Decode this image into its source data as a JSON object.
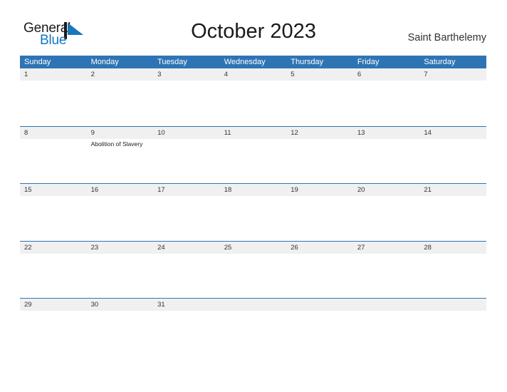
{
  "brand": {
    "name_part1": "General",
    "name_part2": "Blue",
    "mark_icon": "sail-triangle-icon",
    "dark_color": "#1a1a1a",
    "blue_color": "#1077c3"
  },
  "header": {
    "title": "October 2023",
    "region": "Saint Barthelemy"
  },
  "theme": {
    "header_blue": "#2e74b5",
    "day_band_gray": "#f0f0f0",
    "row_rule_blue": "#2e74b5",
    "text_dark": "#333333"
  },
  "calendar": {
    "weekdays": [
      "Sunday",
      "Monday",
      "Tuesday",
      "Wednesday",
      "Thursday",
      "Friday",
      "Saturday"
    ],
    "weeks": [
      {
        "days": [
          {
            "num": "1",
            "events": []
          },
          {
            "num": "2",
            "events": []
          },
          {
            "num": "3",
            "events": []
          },
          {
            "num": "4",
            "events": []
          },
          {
            "num": "5",
            "events": []
          },
          {
            "num": "6",
            "events": []
          },
          {
            "num": "7",
            "events": []
          }
        ]
      },
      {
        "days": [
          {
            "num": "8",
            "events": []
          },
          {
            "num": "9",
            "events": [
              "Abolition of Slavery"
            ]
          },
          {
            "num": "10",
            "events": []
          },
          {
            "num": "11",
            "events": []
          },
          {
            "num": "12",
            "events": []
          },
          {
            "num": "13",
            "events": []
          },
          {
            "num": "14",
            "events": []
          }
        ]
      },
      {
        "days": [
          {
            "num": "15",
            "events": []
          },
          {
            "num": "16",
            "events": []
          },
          {
            "num": "17",
            "events": []
          },
          {
            "num": "18",
            "events": []
          },
          {
            "num": "19",
            "events": []
          },
          {
            "num": "20",
            "events": []
          },
          {
            "num": "21",
            "events": []
          }
        ]
      },
      {
        "days": [
          {
            "num": "22",
            "events": []
          },
          {
            "num": "23",
            "events": []
          },
          {
            "num": "24",
            "events": []
          },
          {
            "num": "25",
            "events": []
          },
          {
            "num": "26",
            "events": []
          },
          {
            "num": "27",
            "events": []
          },
          {
            "num": "28",
            "events": []
          }
        ]
      },
      {
        "days": [
          {
            "num": "29",
            "events": []
          },
          {
            "num": "30",
            "events": []
          },
          {
            "num": "31",
            "events": []
          },
          {
            "num": "",
            "events": []
          },
          {
            "num": "",
            "events": []
          },
          {
            "num": "",
            "events": []
          },
          {
            "num": "",
            "events": []
          }
        ]
      }
    ]
  }
}
